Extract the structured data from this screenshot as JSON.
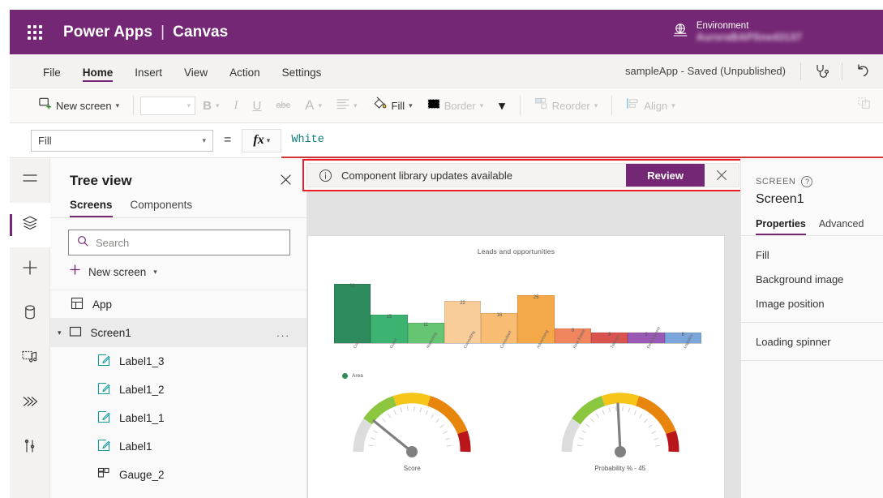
{
  "topbar": {
    "waffle_icon": "waffle-grid-icon",
    "brand": "Power Apps",
    "divider": "|",
    "product": "Canvas",
    "env_icon": "environment-globe-icon",
    "env_label": "Environment",
    "env_name": "AuroraBAPSne43137"
  },
  "menu": {
    "items": [
      {
        "label": "File",
        "active": false
      },
      {
        "label": "Home",
        "active": true
      },
      {
        "label": "Insert",
        "active": false
      },
      {
        "label": "View",
        "active": false
      },
      {
        "label": "Action",
        "active": false
      },
      {
        "label": "Settings",
        "active": false
      }
    ],
    "app_status": "sampleApp - Saved (Unpublished)",
    "checker_icon": "app-checker-stethoscope-icon",
    "undo_icon": "undo-arrow-icon"
  },
  "ribbon": {
    "new_screen": "New screen",
    "new_screen_icon": "new-screen-icon",
    "font_value": "",
    "bold": "B",
    "italic": "I",
    "underline": "U",
    "strikethrough": "abc",
    "font_color": "A",
    "align_icon": "text-align-icon",
    "fill": "Fill",
    "fill_icon": "paint-bucket-icon",
    "border": "Border",
    "border_icon": "border-icon",
    "more_chevron_icon": "chevron-down-icon",
    "reorder": "Reorder",
    "reorder_icon": "reorder-icon",
    "align": "Align",
    "align_group_icon": "align-icon",
    "group_icon": "group-icon"
  },
  "formula": {
    "property": "Fill",
    "equals": "=",
    "fx": "fx",
    "value": "White"
  },
  "rail": {
    "items": [
      {
        "name": "menu-hamburger",
        "icon": "hamburger-menu-icon",
        "active": false
      },
      {
        "name": "tree-view",
        "icon": "layers-icon",
        "active": true
      },
      {
        "name": "insert",
        "icon": "plus-icon",
        "active": false
      },
      {
        "name": "data",
        "icon": "database-icon",
        "active": false
      },
      {
        "name": "media",
        "icon": "media-icon",
        "active": false
      },
      {
        "name": "power-automate",
        "icon": "flows-icon",
        "active": false
      },
      {
        "name": "advanced-tools",
        "icon": "tools-icon",
        "active": false
      }
    ]
  },
  "tree": {
    "title": "Tree view",
    "close_icon": "close-icon",
    "tabs": [
      {
        "label": "Screens",
        "active": true
      },
      {
        "label": "Components",
        "active": false
      }
    ],
    "search_placeholder": "Search",
    "search_value": "",
    "search_icon": "search-icon",
    "new_screen": "New screen",
    "new_screen_icon": "plus-icon",
    "items": [
      {
        "label": "App",
        "icon": "app-icon",
        "level": 0,
        "selected": false,
        "expandable": false
      },
      {
        "label": "Screen1",
        "icon": "screen-icon",
        "level": 0,
        "selected": true,
        "expandable": true,
        "menu": "..."
      },
      {
        "label": "Label1_3",
        "icon": "label-icon",
        "level": 1,
        "selected": false
      },
      {
        "label": "Label1_2",
        "icon": "label-icon",
        "level": 1,
        "selected": false
      },
      {
        "label": "Label1_1",
        "icon": "label-icon",
        "level": 1,
        "selected": false
      },
      {
        "label": "Label1",
        "icon": "label-icon",
        "level": 1,
        "selected": false
      },
      {
        "label": "Gauge_2",
        "icon": "gauge-component-icon",
        "level": 1,
        "selected": false
      }
    ]
  },
  "banner": {
    "info_icon": "info-circle-icon",
    "message": "Component library updates available",
    "review_label": "Review",
    "close_icon": "close-icon",
    "highlight_color": "#ee1c25",
    "accent_color": "#742774"
  },
  "properties": {
    "kind": "SCREEN",
    "help_icon": "help-circle-icon",
    "name": "Screen1",
    "tabs": [
      {
        "label": "Properties",
        "active": true
      },
      {
        "label": "Advanced",
        "active": false
      }
    ],
    "group_a": [
      "Fill",
      "Background image",
      "Image position"
    ],
    "group_b": [
      "Loading spinner"
    ]
  },
  "chart_data": [
    {
      "type": "bar",
      "title": "Leads and opportunities",
      "categories": [
        "Corp",
        "Outlet",
        "Marketing",
        "Consulting",
        "Consultant",
        "Advertising",
        "Real Estate",
        "Telecom",
        "Development",
        "Logistics"
      ],
      "values": [
        31,
        15,
        11,
        22,
        16,
        25,
        8,
        6,
        6,
        6
      ],
      "colors": [
        "#2e8b5e",
        "#3cb371",
        "#66c572",
        "#f9cd9a",
        "#f8bd72",
        "#f5a847",
        "#f0855e",
        "#d9534f",
        "#9b59b6",
        "#7aa6dc"
      ],
      "legend": [
        {
          "name": "Area",
          "color": "#2f8a5b"
        }
      ],
      "legend_position": "bottom-left",
      "ylim": [
        0,
        33
      ],
      "xlabel": "",
      "ylabel": "",
      "grid": false,
      "data_labels": true
    },
    {
      "type": "gauge",
      "label": "Score",
      "value": 20,
      "min": 0,
      "max": 100,
      "bands": [
        {
          "color": "#dcdcdc",
          "to": 12
        },
        {
          "color": "#8cc63e",
          "to": 32
        },
        {
          "color": "#f5c518",
          "to": 55
        },
        {
          "color": "#e8850c",
          "to": 82
        },
        {
          "color": "#b8161a",
          "to": 100
        }
      ]
    },
    {
      "type": "gauge",
      "label": "Probability % -  45",
      "value": 45,
      "min": 0,
      "max": 100,
      "bands": [
        {
          "color": "#dcdcdc",
          "to": 12
        },
        {
          "color": "#8cc63e",
          "to": 32
        },
        {
          "color": "#f5c518",
          "to": 55
        },
        {
          "color": "#e8850c",
          "to": 82
        },
        {
          "color": "#b8161a",
          "to": 100
        }
      ]
    }
  ]
}
